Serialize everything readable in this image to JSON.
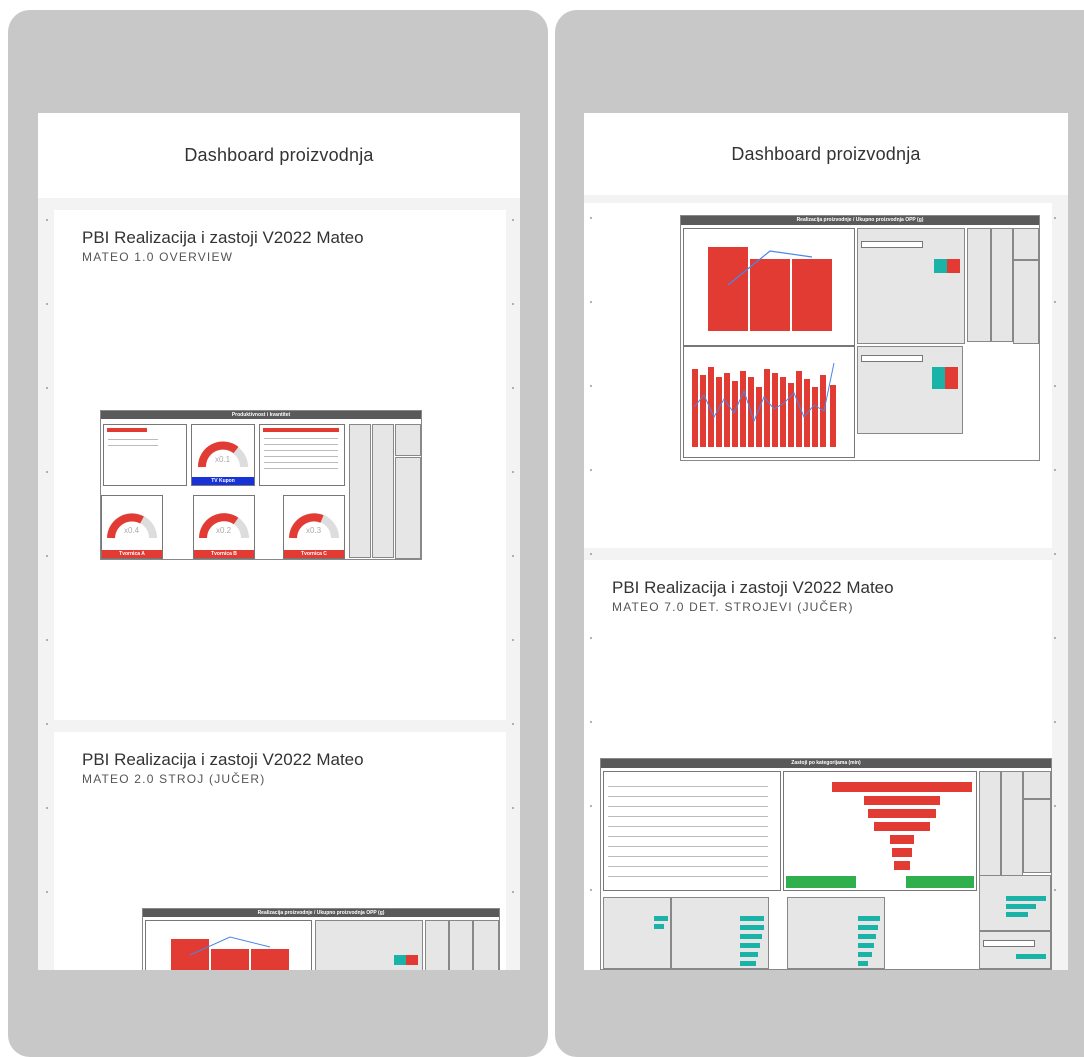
{
  "left_phone": {
    "header_title": "Dashboard proizvodnja",
    "tiles": [
      {
        "title": "PBI Realizacija i zastoji V2022 Mateo",
        "subtitle": "MATEO 1.0 OVERVIEW"
      },
      {
        "title": "PBI Realizacija i zastoji V2022 Mateo",
        "subtitle": "MATEO 2.0 STROJ (JUČER)"
      }
    ]
  },
  "right_phone": {
    "header_title": "Dashboard proizvodnja",
    "tiles": [
      {
        "title": "PBI Realizacija i zastoji V2022 Mateo",
        "subtitle": "MATEO 7.0 DET. STROJEVI (JUČER)"
      }
    ]
  },
  "thumbnails": {
    "overview_title": "Produktivnost i kvantitet",
    "gauge_values": [
      "x0.1",
      "x0.4",
      "x0.2",
      "x0.3"
    ],
    "gauge_badges": [
      "TV Kupon",
      "Tvornica A",
      "Tvornica B",
      "Tvornica C"
    ],
    "machine_title": "Realizacija proizvodnje / Ukupno proizvodnja   OPP (g)",
    "downtime_title": "Zastoji po kategorijama (min)"
  },
  "colors": {
    "frame": "#c8c8c8",
    "accent_red": "#e23b33",
    "teal": "#19b3a8",
    "blue": "#1632d8"
  }
}
